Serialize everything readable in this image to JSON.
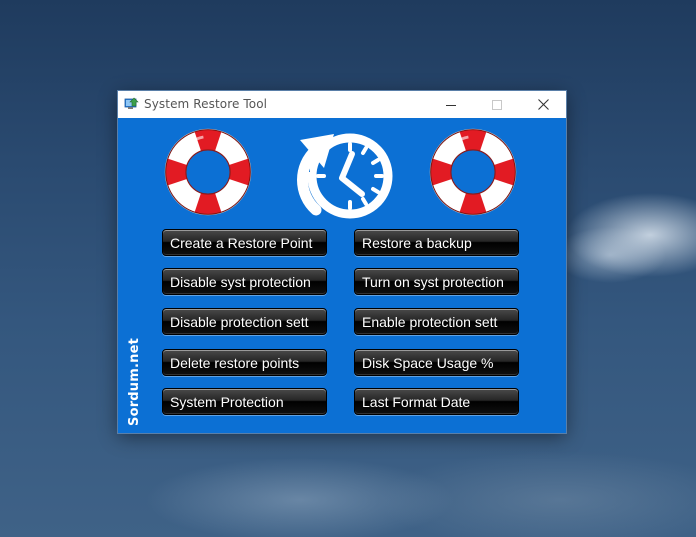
{
  "window": {
    "title": "System Restore Tool",
    "controls": {
      "minimize": "minimize",
      "maximize": "maximize",
      "close": "close"
    }
  },
  "icons": {
    "app": "app-icon",
    "left": "lifebuoy-icon",
    "center": "clock-restore-icon",
    "right": "lifebuoy-icon"
  },
  "buttons": {
    "create_restore_point": "Create a Restore Point",
    "restore_backup": "Restore a backup",
    "disable_syst_protection": "Disable syst protection",
    "turn_on_syst_protection": "Turn on syst protection",
    "disable_protection_sett": "Disable protection sett",
    "enable_protection_sett": "Enable protection sett",
    "delete_restore_points": "Delete restore points",
    "disk_space_usage": "Disk Space Usage %",
    "system_protection": "System Protection",
    "last_format_date": "Last Format Date"
  },
  "brand": "Sordum.net",
  "colors": {
    "window_bg": "#0c70d4",
    "button_bg": "#000000",
    "button_text": "#ffffff",
    "lifebuoy_red": "#e21b23",
    "lifebuoy_white": "#ffffff"
  }
}
